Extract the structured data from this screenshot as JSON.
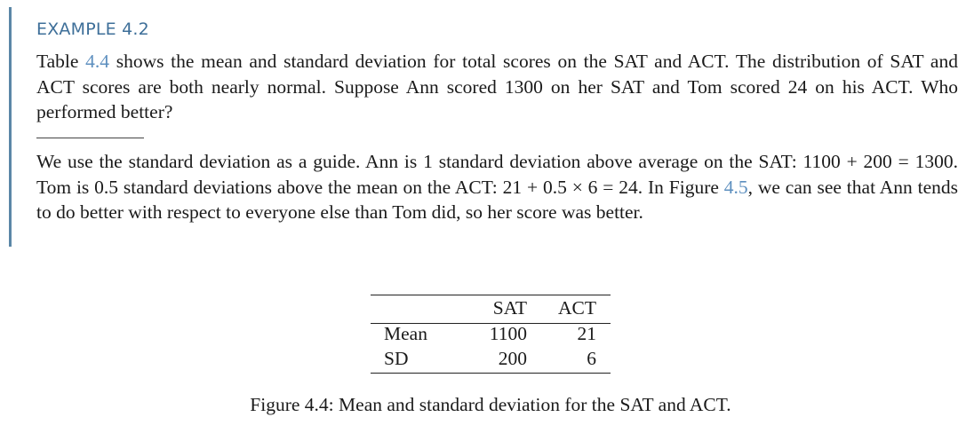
{
  "example": {
    "title": "EXAMPLE 4.2",
    "question": {
      "part1": "Table ",
      "table_ref": "4.4",
      "part2": " shows the mean and standard deviation for total scores on the SAT and ACT. The distribution of SAT and ACT scores are both nearly normal. Suppose Ann scored 1300 on her SAT and Tom scored 24 on his ACT. Who performed better?"
    },
    "answer": {
      "part1": "We use the standard deviation as a guide. Ann is 1 standard deviation above average on the SAT: 1100 + 200 = 1300. Tom is 0.5 standard deviations above the mean on the ACT: 21 + 0.5 × 6 = 24. In Figure ",
      "figure_ref": "4.5",
      "part2": ", we can see that Ann tends to do better with respect to everyone else than Tom did, so her score was better."
    }
  },
  "table": {
    "headers": [
      "",
      "SAT",
      "ACT"
    ],
    "rows": [
      {
        "label": "Mean",
        "sat": "1100",
        "act": "21"
      },
      {
        "label": "SD",
        "sat": "200",
        "act": "6"
      }
    ]
  },
  "caption": "Figure 4.4: Mean and standard deviation for the SAT and ACT.",
  "colors": {
    "title": "#3e6f99",
    "reference_link": "#5d8fbf",
    "side_rule": "#5b87a7"
  }
}
